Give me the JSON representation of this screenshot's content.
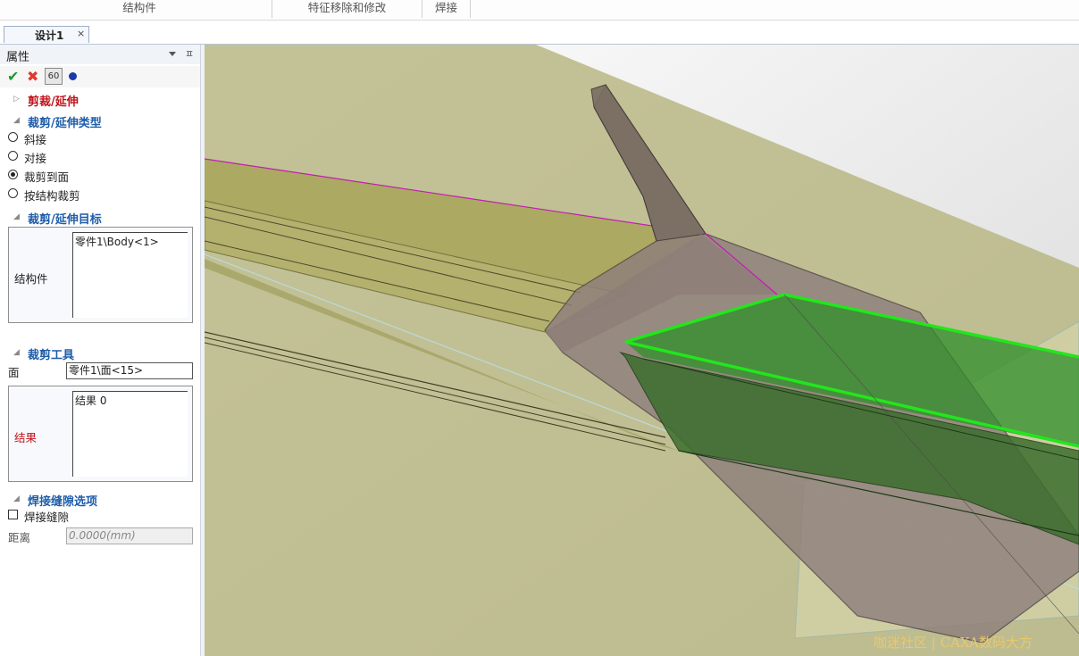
{
  "ribbon": {
    "groups": [
      "结构件",
      "特征移除和修改",
      "焊接"
    ]
  },
  "tabs": {
    "doc_tab": "设计1",
    "close_glyph": "×"
  },
  "panel": {
    "title": "属性",
    "pin_glyph": "ㅍ",
    "toolbar": {
      "ok": "✔",
      "cancel": "✖",
      "preview": "60"
    },
    "feature_title": "剪裁/延伸",
    "trim_type": {
      "title": "裁剪/延伸类型",
      "options": [
        "斜接",
        "对接",
        "裁剪到面",
        "按结构裁剪"
      ],
      "selected": "裁剪到面"
    },
    "target": {
      "title": "裁剪/延伸目标",
      "side_label": "结构件",
      "item": "零件1\\Body<1>"
    },
    "tool": {
      "title": "裁剪工具",
      "face_label": "面",
      "face_value": "零件1\\面<15>",
      "result_side_label": "结果",
      "result_item": "结果 0"
    },
    "weld_gap": {
      "title": "焊接缝隙选项",
      "checkbox_label": "焊接缝隙",
      "checked": false,
      "distance_label": "距离",
      "distance_value": "0.0000(mm)"
    }
  },
  "watermark": "咖迷社区 | CAXA数码大方",
  "colors": {
    "section_title": "#1f5da8",
    "feature_title": "#c0141c",
    "result_label": "#c0141c",
    "highlight_edge": "#22e61c",
    "trim_line": "#c21cb4"
  }
}
